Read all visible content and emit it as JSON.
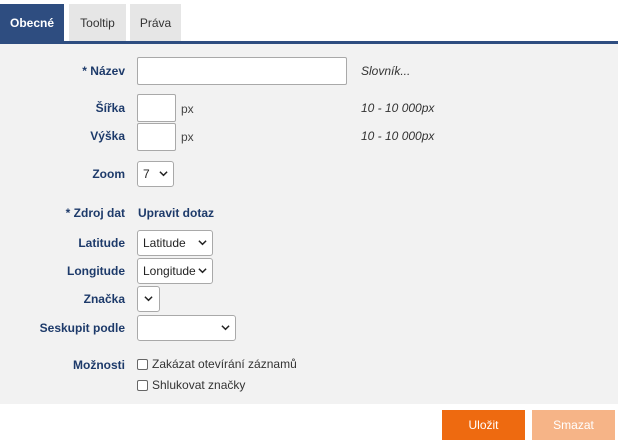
{
  "tabs": [
    "Obecné",
    "Tooltip",
    "Práva"
  ],
  "fields": {
    "nazev": {
      "label": "* Název",
      "value": "",
      "hint": "Slovník..."
    },
    "sirka": {
      "label": "Šířka",
      "value": "",
      "unit": "px",
      "hint": "10 - 10 000px"
    },
    "vyska": {
      "label": "Výška",
      "value": "",
      "unit": "px",
      "hint": "10 - 10 000px"
    },
    "zoom": {
      "label": "Zoom",
      "value": "7"
    },
    "zdroj": {
      "label": "* Zdroj dat",
      "link": "Upravit dotaz"
    },
    "latitude": {
      "label": "Latitude",
      "value": "Latitude"
    },
    "longitude": {
      "label": "Longitude",
      "value": "Longitude"
    },
    "znacka": {
      "label": "Značka",
      "value": ""
    },
    "seskupit": {
      "label": "Seskupit podle",
      "value": ""
    },
    "moznosti": {
      "label": "Možnosti",
      "options": [
        {
          "label": "Zakázat otevírání záznamů",
          "checked": false
        },
        {
          "label": "Shlukovat značky",
          "checked": false
        }
      ]
    }
  },
  "buttons": {
    "save": "Uložit",
    "delete": "Smazat"
  },
  "colors": {
    "tab_active": "#2e4d80",
    "save": "#ee6a10",
    "delete": "#f6b487",
    "label": "#1d3a6a"
  }
}
